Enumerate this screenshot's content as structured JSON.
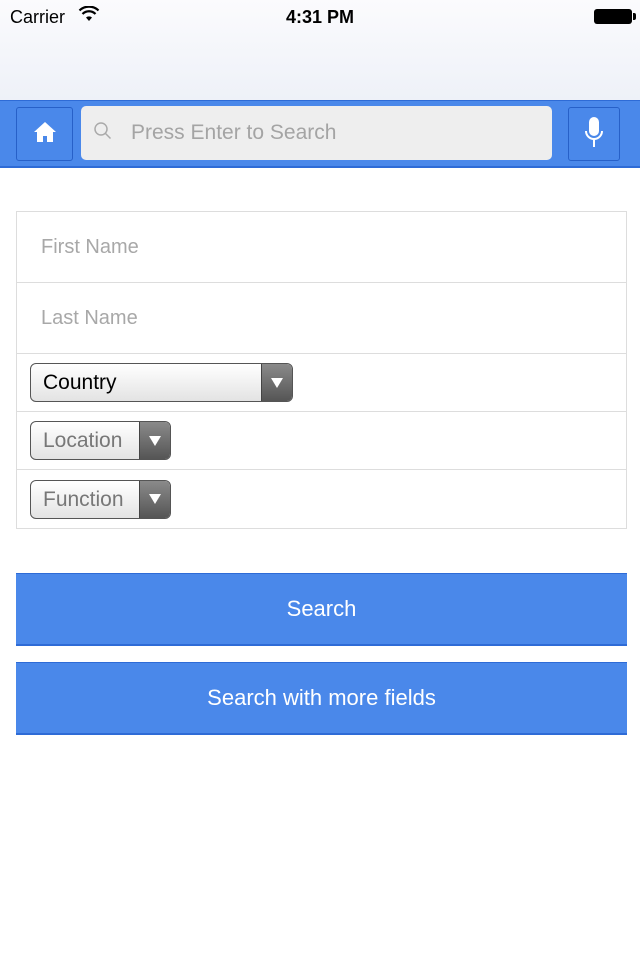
{
  "status_bar": {
    "carrier": "Carrier",
    "time": "4:31 PM"
  },
  "toolbar": {
    "home_icon": "home-icon",
    "search_placeholder": "Press Enter to Search",
    "mic_icon": "microphone-icon",
    "accent": "#4a88ea"
  },
  "form": {
    "first_name_placeholder": "First Name",
    "last_name_placeholder": "Last Name",
    "country": "Country",
    "location": "Location",
    "function": "Function"
  },
  "buttons": {
    "search": "Search",
    "search_more": "Search with more fields"
  }
}
